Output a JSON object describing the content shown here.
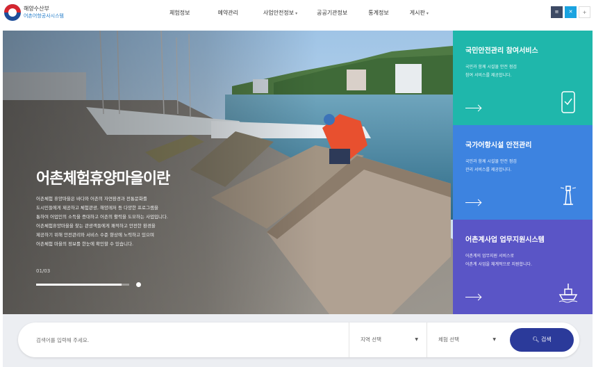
{
  "header": {
    "logo": {
      "line1": "해양수산부",
      "line2": "어촌어항공사시스템"
    },
    "nav": [
      {
        "label": "체험정보",
        "has_dropdown": false
      },
      {
        "label": "예약관리",
        "has_dropdown": false
      },
      {
        "label": "사업안전정보",
        "has_dropdown": true
      },
      {
        "label": "공공기관정보",
        "has_dropdown": false
      },
      {
        "label": "통계정보",
        "has_dropdown": false
      },
      {
        "label": "게시판",
        "has_dropdown": true
      }
    ],
    "buttons": [
      {
        "label": "≡",
        "color": "#3d4a64"
      },
      {
        "label": "✕",
        "color": "#1aa3e0"
      },
      {
        "label": "+",
        "color": "#ffffff"
      }
    ]
  },
  "hero": {
    "title": "어촌체험휴양마을이란",
    "description": [
      "어촌체험 휴양마을은 바다와 어촌의 자연환경과 전통문화를",
      "도시민들에게 제공하고 체험관광, 해양레저 등 다양한 프로그램을",
      "통하여 어업인의 소득을 증대하고 어촌의 활력을 도모하는 사업입니다.",
      "어촌체험휴양마을을 찾는 관광객들에게 쾌적하고 안전한 환경을",
      "제공하기 위해 안전관리와 서비스 수준 향상에 노력하고 있으며",
      "어촌체험 마을의 정보를 한눈에 확인할 수 있습니다."
    ],
    "slide_counter": "01/03",
    "progress": 0.92
  },
  "panels": [
    {
      "title": "국민안전관리 참여서비스",
      "text": [
        "국민과 함께 시설물 안전 점검",
        "참여 서비스를 제공합니다."
      ],
      "icon": "phone-check-icon",
      "color": "#1fb7ab"
    },
    {
      "title": "국가어항시설 안전관리",
      "text": [
        "국민과 함께 시설물 안전 점검",
        "관리 서비스를 제공합니다."
      ],
      "icon": "lighthouse-icon",
      "color": "#3d83e0"
    },
    {
      "title": "어촌계사업 업무지원시스템",
      "text": [
        "어촌계의 업무지원 서비스로",
        "어촌계 사업을 체계적으로 지원합니다."
      ],
      "icon": "boat-icon",
      "color": "#5a55c6"
    }
  ],
  "search": {
    "placeholder": "검색어를 입력해 주세요.",
    "region_select": "지역 선택",
    "category_select": "체험 선택",
    "button_label": "검색"
  }
}
